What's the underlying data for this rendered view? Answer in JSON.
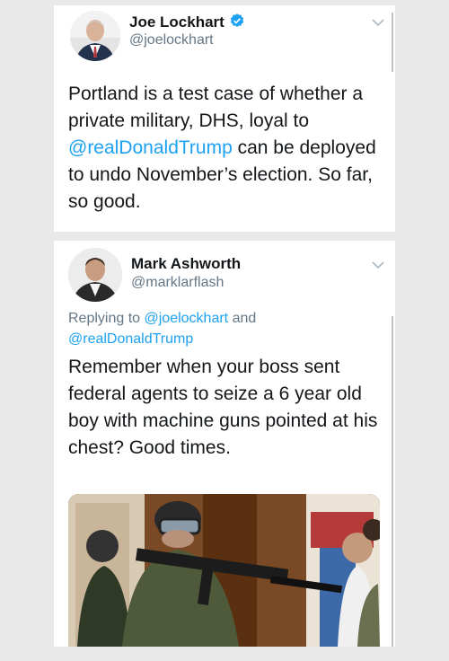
{
  "tweet1": {
    "name": "Joe Lockhart",
    "handle": "@joelockhart",
    "verified": true,
    "text_before": "Portland is a test case of whether a private military, DHS, loyal to ",
    "mention": "@realDonaldTrump",
    "text_after": " can be deployed to undo November’s election.  So far, so good."
  },
  "tweet2": {
    "name": "Mark Ashworth",
    "handle": "@marklarflash",
    "reply_prefix": "Replying to ",
    "reply_to_1": "@joelockhart",
    "reply_and": " and ",
    "reply_to_2": "@realDonaldTrump",
    "text": "Remember when your boss sent federal agents to seize a 6 year old boy with machine guns pointed at his chest? Good times."
  },
  "colors": {
    "link": "#1da1f2",
    "verified": "#1da1f2",
    "text": "#14171a",
    "muted": "#657786",
    "background": "#e9e9e9"
  },
  "icons": {
    "verified": "verified-badge-icon",
    "menu": "chevron-down-icon"
  }
}
